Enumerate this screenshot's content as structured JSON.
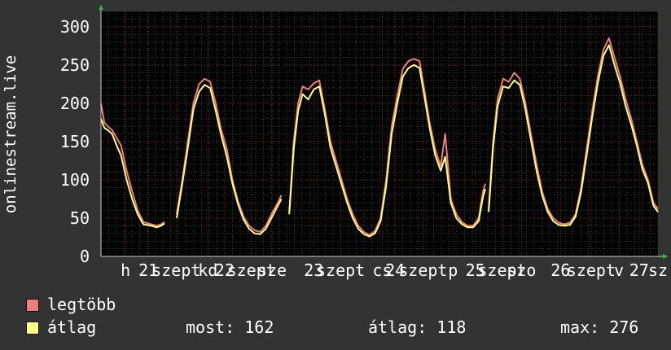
{
  "chart_data": {
    "type": "line",
    "ylabel": "onlinestream.live",
    "ylim": [
      0,
      320
    ],
    "yticks": [
      0,
      50,
      100,
      150,
      200,
      250,
      300
    ],
    "xlim": [
      0,
      1
    ],
    "grid": true,
    "xtick_labels": [
      {
        "label": "h",
        "x": 0.044
      },
      {
        "label": "21",
        "x": 0.085
      },
      {
        "label": "szept",
        "x": 0.135
      },
      {
        "label": "kd",
        "x": 0.192
      },
      {
        "label": "22",
        "x": 0.222
      },
      {
        "label": "szept",
        "x": 0.27
      },
      {
        "label": "sze",
        "x": 0.307
      },
      {
        "label": "23",
        "x": 0.382
      },
      {
        "label": "szept",
        "x": 0.43
      },
      {
        "label": "cs",
        "x": 0.505
      },
      {
        "label": "24",
        "x": 0.528
      },
      {
        "label": "szept",
        "x": 0.578
      },
      {
        "label": "p",
        "x": 0.632
      },
      {
        "label": "25",
        "x": 0.672
      },
      {
        "label": "szept",
        "x": 0.72
      },
      {
        "label": "szo",
        "x": 0.755
      },
      {
        "label": "26",
        "x": 0.825
      },
      {
        "label": "szept",
        "x": 0.88
      },
      {
        "label": "v",
        "x": 0.93
      },
      {
        "label": "27",
        "x": 0.966
      },
      {
        "label": "sz",
        "x": 1.0
      }
    ],
    "series": [
      {
        "name": "legtöbb",
        "color": "#f07c7c",
        "segments": [
          [
            [
              0.0,
              200
            ],
            [
              0.006,
              175
            ],
            [
              0.012,
              170
            ],
            [
              0.02,
              165
            ],
            [
              0.028,
              155
            ],
            [
              0.036,
              145
            ],
            [
              0.046,
              112
            ],
            [
              0.056,
              85
            ],
            [
              0.066,
              60
            ],
            [
              0.076,
              45
            ],
            [
              0.09,
              42
            ],
            [
              0.1,
              40
            ],
            [
              0.108,
              42
            ],
            [
              0.114,
              45
            ]
          ],
          [
            [
              0.136,
              55
            ],
            [
              0.146,
              100
            ],
            [
              0.156,
              150
            ],
            [
              0.166,
              200
            ],
            [
              0.176,
              225
            ],
            [
              0.186,
              232
            ],
            [
              0.196,
              228
            ],
            [
              0.206,
              200
            ],
            [
              0.216,
              165
            ],
            [
              0.226,
              140
            ],
            [
              0.236,
              100
            ],
            [
              0.246,
              72
            ],
            [
              0.256,
              52
            ],
            [
              0.266,
              40
            ],
            [
              0.276,
              34
            ],
            [
              0.286,
              32
            ],
            [
              0.296,
              40
            ],
            [
              0.306,
              55
            ],
            [
              0.316,
              68
            ],
            [
              0.324,
              80
            ]
          ],
          [
            [
              0.338,
              58
            ],
            [
              0.346,
              150
            ],
            [
              0.354,
              200
            ],
            [
              0.362,
              222
            ],
            [
              0.372,
              218
            ],
            [
              0.382,
              226
            ],
            [
              0.392,
              230
            ],
            [
              0.402,
              192
            ],
            [
              0.412,
              150
            ],
            [
              0.422,
              125
            ],
            [
              0.432,
              100
            ],
            [
              0.442,
              75
            ],
            [
              0.452,
              55
            ],
            [
              0.462,
              40
            ],
            [
              0.472,
              32
            ],
            [
              0.482,
              28
            ],
            [
              0.492,
              33
            ],
            [
              0.502,
              50
            ],
            [
              0.512,
              100
            ],
            [
              0.522,
              170
            ],
            [
              0.532,
              210
            ],
            [
              0.542,
              245
            ],
            [
              0.552,
              255
            ],
            [
              0.562,
              258
            ],
            [
              0.572,
              255
            ],
            [
              0.58,
              220
            ],
            [
              0.59,
              175
            ],
            [
              0.6,
              140
            ],
            [
              0.61,
              118
            ],
            [
              0.618,
              160
            ],
            [
              0.628,
              75
            ],
            [
              0.638,
              55
            ],
            [
              0.648,
              45
            ],
            [
              0.658,
              40
            ],
            [
              0.668,
              40
            ],
            [
              0.678,
              50
            ],
            [
              0.686,
              85
            ],
            [
              0.69,
              95
            ]
          ],
          [
            [
              0.696,
              62
            ],
            [
              0.704,
              150
            ],
            [
              0.712,
              205
            ],
            [
              0.722,
              232
            ],
            [
              0.732,
              228
            ],
            [
              0.742,
              240
            ],
            [
              0.752,
              232
            ],
            [
              0.762,
              200
            ],
            [
              0.772,
              160
            ],
            [
              0.782,
              120
            ],
            [
              0.792,
              85
            ],
            [
              0.802,
              62
            ],
            [
              0.812,
              50
            ],
            [
              0.822,
              44
            ],
            [
              0.832,
              42
            ],
            [
              0.842,
              44
            ],
            [
              0.852,
              55
            ],
            [
              0.862,
              90
            ],
            [
              0.872,
              140
            ],
            [
              0.882,
              190
            ],
            [
              0.892,
              235
            ],
            [
              0.902,
              270
            ],
            [
              0.912,
              285
            ],
            [
              0.922,
              260
            ],
            [
              0.932,
              235
            ],
            [
              0.942,
              205
            ],
            [
              0.952,
              180
            ],
            [
              0.962,
              150
            ],
            [
              0.972,
              120
            ],
            [
              0.982,
              100
            ],
            [
              0.992,
              70
            ],
            [
              1.0,
              62
            ]
          ]
        ]
      },
      {
        "name": "átlag",
        "color": "#ffff80",
        "segments": [
          [
            [
              0.0,
              180
            ],
            [
              0.006,
              168
            ],
            [
              0.012,
              165
            ],
            [
              0.02,
              160
            ],
            [
              0.028,
              145
            ],
            [
              0.036,
              132
            ],
            [
              0.046,
              100
            ],
            [
              0.056,
              75
            ],
            [
              0.066,
              55
            ],
            [
              0.076,
              42
            ],
            [
              0.09,
              40
            ],
            [
              0.1,
              38
            ],
            [
              0.108,
              40
            ],
            [
              0.114,
              43
            ]
          ],
          [
            [
              0.136,
              50
            ],
            [
              0.146,
              95
            ],
            [
              0.156,
              142
            ],
            [
              0.166,
              192
            ],
            [
              0.176,
              215
            ],
            [
              0.186,
              224
            ],
            [
              0.196,
              220
            ],
            [
              0.206,
              190
            ],
            [
              0.216,
              158
            ],
            [
              0.226,
              130
            ],
            [
              0.236,
              95
            ],
            [
              0.246,
              68
            ],
            [
              0.256,
              48
            ],
            [
              0.266,
              36
            ],
            [
              0.276,
              30
            ],
            [
              0.286,
              29
            ],
            [
              0.296,
              36
            ],
            [
              0.306,
              50
            ],
            [
              0.316,
              64
            ],
            [
              0.324,
              75
            ]
          ],
          [
            [
              0.338,
              55
            ],
            [
              0.346,
              140
            ],
            [
              0.354,
              190
            ],
            [
              0.362,
              212
            ],
            [
              0.372,
              205
            ],
            [
              0.382,
              218
            ],
            [
              0.392,
              222
            ],
            [
              0.402,
              185
            ],
            [
              0.412,
              142
            ],
            [
              0.422,
              118
            ],
            [
              0.432,
              94
            ],
            [
              0.442,
              70
            ],
            [
              0.452,
              50
            ],
            [
              0.462,
              36
            ],
            [
              0.472,
              29
            ],
            [
              0.482,
              26
            ],
            [
              0.492,
              30
            ],
            [
              0.502,
              46
            ],
            [
              0.512,
              92
            ],
            [
              0.522,
              160
            ],
            [
              0.532,
              200
            ],
            [
              0.542,
              235
            ],
            [
              0.552,
              246
            ],
            [
              0.562,
              250
            ],
            [
              0.572,
              246
            ],
            [
              0.58,
              212
            ],
            [
              0.59,
              168
            ],
            [
              0.6,
              132
            ],
            [
              0.61,
              112
            ],
            [
              0.618,
              130
            ],
            [
              0.628,
              70
            ],
            [
              0.638,
              50
            ],
            [
              0.648,
              42
            ],
            [
              0.658,
              38
            ],
            [
              0.668,
              38
            ],
            [
              0.678,
              46
            ],
            [
              0.686,
              78
            ],
            [
              0.69,
              88
            ]
          ],
          [
            [
              0.696,
              58
            ],
            [
              0.704,
              142
            ],
            [
              0.712,
              196
            ],
            [
              0.722,
              222
            ],
            [
              0.732,
              220
            ],
            [
              0.742,
              230
            ],
            [
              0.752,
              224
            ],
            [
              0.762,
              192
            ],
            [
              0.772,
              152
            ],
            [
              0.782,
              112
            ],
            [
              0.792,
              80
            ],
            [
              0.802,
              58
            ],
            [
              0.812,
              46
            ],
            [
              0.822,
              41
            ],
            [
              0.832,
              40
            ],
            [
              0.842,
              41
            ],
            [
              0.852,
              52
            ],
            [
              0.862,
              84
            ],
            [
              0.872,
              132
            ],
            [
              0.882,
              182
            ],
            [
              0.892,
              226
            ],
            [
              0.902,
              262
            ],
            [
              0.912,
              276
            ],
            [
              0.922,
              250
            ],
            [
              0.932,
              226
            ],
            [
              0.942,
              196
            ],
            [
              0.952,
              172
            ],
            [
              0.962,
              145
            ],
            [
              0.972,
              114
            ],
            [
              0.982,
              96
            ],
            [
              0.992,
              66
            ],
            [
              1.0,
              58
            ]
          ]
        ]
      }
    ]
  },
  "legend": {
    "items": [
      {
        "label": "legtöbb",
        "color": "#f07c7c"
      },
      {
        "label": "átlag",
        "color": "#ffff80"
      }
    ],
    "stats": {
      "most": "most: 162",
      "atlag": "átlag: 118",
      "max": "max: 276"
    }
  }
}
